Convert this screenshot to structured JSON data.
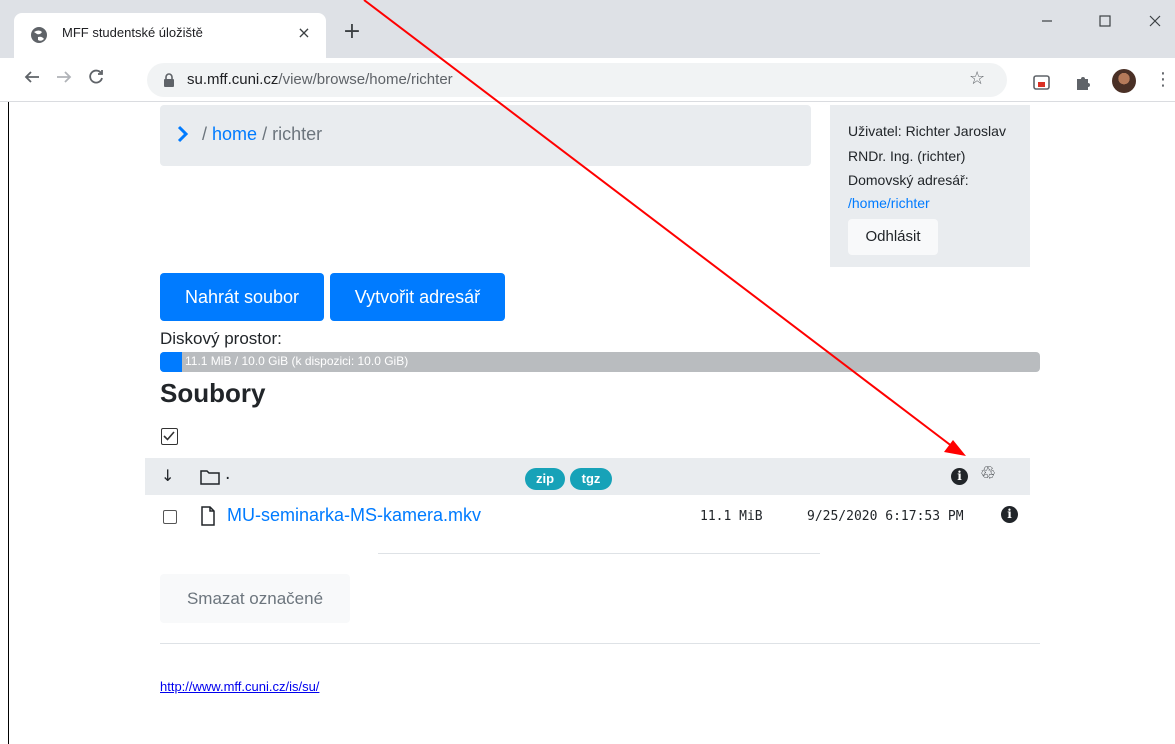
{
  "browser": {
    "tab_title": "MFF studentské úložiště",
    "tab_close": "×",
    "new_tab": "+",
    "url_host": "su.mff.cuni.cz",
    "url_path": "/view/browse/home/richter",
    "window_controls": {
      "minimize": "—",
      "maximize": "☐",
      "close": "✕"
    }
  },
  "breadcrumb": {
    "separator1": "/",
    "home_label": "home",
    "separator2": "/",
    "current": "richter"
  },
  "user_panel": {
    "user_line": "Uživatel: Richter Jaroslav",
    "title_line": "RNDr. Ing. (richter)",
    "home_label": "Domovský adresář:",
    "home_path": "/home/richter",
    "logout_label": "Odhlásit"
  },
  "actions": {
    "upload_label": "Nahrát soubor",
    "mkdir_label": "Vytvořit adresář"
  },
  "disk": {
    "label": "Diskový prostor:",
    "usage_text": "11.1 MiB / 10.0 GiB (k dispozici: 10.0 GiB)",
    "used_fraction": 0.0011
  },
  "files": {
    "heading": "Soubory",
    "dir_row": {
      "sort_arrow": "↓",
      "name": ".",
      "badges": [
        "zip",
        "tgz"
      ]
    },
    "rows": [
      {
        "name": "MU-seminarka-MS-kamera.mkv",
        "size": "11.1 MiB",
        "modified": "9/25/2020 6:17:53 PM"
      }
    ],
    "delete_label": "Smazat označené"
  },
  "footer": {
    "link": "http://www.mff.cuni.cz/is/su/"
  },
  "colors": {
    "primary": "#007bff",
    "badge": "#17a2b8",
    "annotation_arrow": "#ff0000"
  }
}
